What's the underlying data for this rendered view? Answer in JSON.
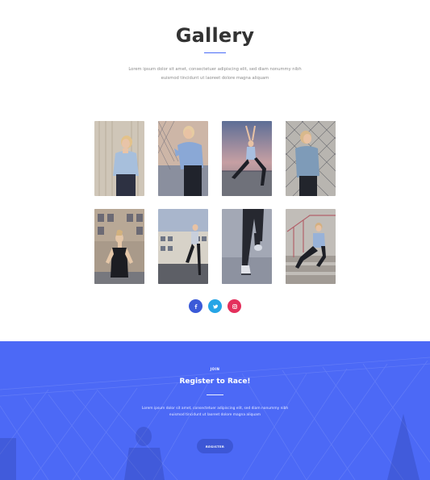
{
  "gallery": {
    "title": "Gallery",
    "description": "Lorem ipsum dolor sit amet, consectetuer adipiscing elit, sed diam nonummy nibh euismod tincidunt ut laoreet dolore magna aliquam",
    "accent_color": "#4a6cf7",
    "photos": [
      {
        "description": "woman-by-wooden-wall"
      },
      {
        "description": "woman-adjusting-hair-by-fence"
      },
      {
        "description": "woman-lunging-on-rooftop"
      },
      {
        "description": "woman-leaning-on-fence"
      },
      {
        "description": "woman-posing-by-building"
      },
      {
        "description": "woman-stretching-in-parking-lot"
      },
      {
        "description": "runner-legs-close-up"
      },
      {
        "description": "woman-sitting-on-stairs"
      }
    ]
  },
  "social": [
    {
      "name": "facebook-icon",
      "glyph": "f",
      "color": "#3b5ad8"
    },
    {
      "name": "twitter-icon",
      "glyph": "t",
      "color": "#26a5e6"
    },
    {
      "name": "instagram-icon",
      "glyph": "ig",
      "color": "#e4305c"
    }
  ],
  "register": {
    "eyebrow": "JOIN",
    "title": "Register to Race!",
    "description": "Lorem ipsum dolor sit amet, consectetuer adipiscing elit, sed diam nonummy nibh euismod tincidunt ut laoreet dolore magna aliquam",
    "button_label": "REGISTER",
    "background_color": "#4c69f6"
  }
}
